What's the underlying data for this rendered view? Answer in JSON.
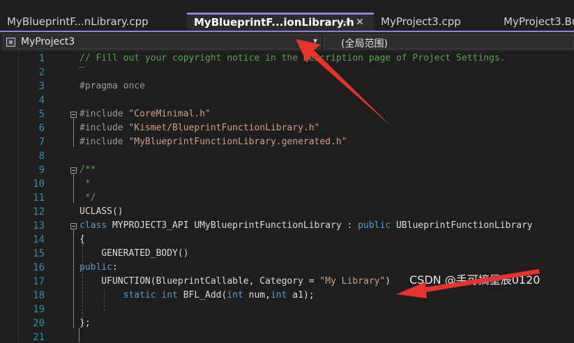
{
  "tabs": [
    {
      "label": "MyBlueprintF...nLibrary.cpp",
      "active": false
    },
    {
      "label": "MyBlueprintF...ionLibrary.h",
      "active": true
    },
    {
      "label": "MyProject3.cpp",
      "active": false
    },
    {
      "label": "MyProject3.Bu",
      "active": false
    }
  ],
  "tab_icons": {
    "pin": "pin-icon",
    "close": "close-icon"
  },
  "navbar": {
    "project": "MyProject3",
    "scope": "(全局范围)"
  },
  "editor": {
    "line_numbers": [
      "1",
      "2",
      "3",
      "4",
      "5",
      "6",
      "7",
      "8",
      "9",
      "10",
      "11",
      "12",
      "13",
      "14",
      "15",
      "16",
      "17",
      "18",
      "19",
      "20",
      "21"
    ],
    "lines": {
      "l1": "// Fill out your copyright notice in the Description page of Project Settings.",
      "l3": "#pragma once",
      "l5_pre": "#include ",
      "l5_str": "\"CoreMinimal.h\"",
      "l6_pre": "#include ",
      "l6_str": "\"Kismet/BlueprintFunctionLibrary.h\"",
      "l7_pre": "#include ",
      "l7_str": "\"MyBlueprintFunctionLibrary.generated.h\"",
      "l9": "/**",
      "l10": " *",
      "l11": " */",
      "l12": "UCLASS()",
      "l13_kw": "class",
      "l13_rest": " MYPROJECT3_API UMyBlueprintFunctionLibrary : ",
      "l13_kw2": "public",
      "l13_base": " UBlueprintFunctionLibrary",
      "l14": "{",
      "l15": "    GENERATED_BODY()",
      "l16_kw": "public",
      "l16_rest": ":",
      "l17_a": "    UFUNCTION(BlueprintCallable, Category = ",
      "l17_str": "\"My Library\"",
      "l17_b": ")",
      "l18_kw1": "        static",
      "l18_sp": " ",
      "l18_kw2": "int",
      "l18_a": " BFL_Add(",
      "l18_kw3": "int",
      "l18_b": " num,",
      "l18_kw4": "int",
      "l18_c": " a1);",
      "l20": "};"
    }
  },
  "watermark": "CSDN @手可摘星辰0120",
  "colors": {
    "accent": "#9283e0",
    "comment": "#57a64a",
    "keyword": "#569cd6",
    "string": "#d69d85",
    "line_number": "#2b91af",
    "annotation_arrow": "#e8332a"
  }
}
